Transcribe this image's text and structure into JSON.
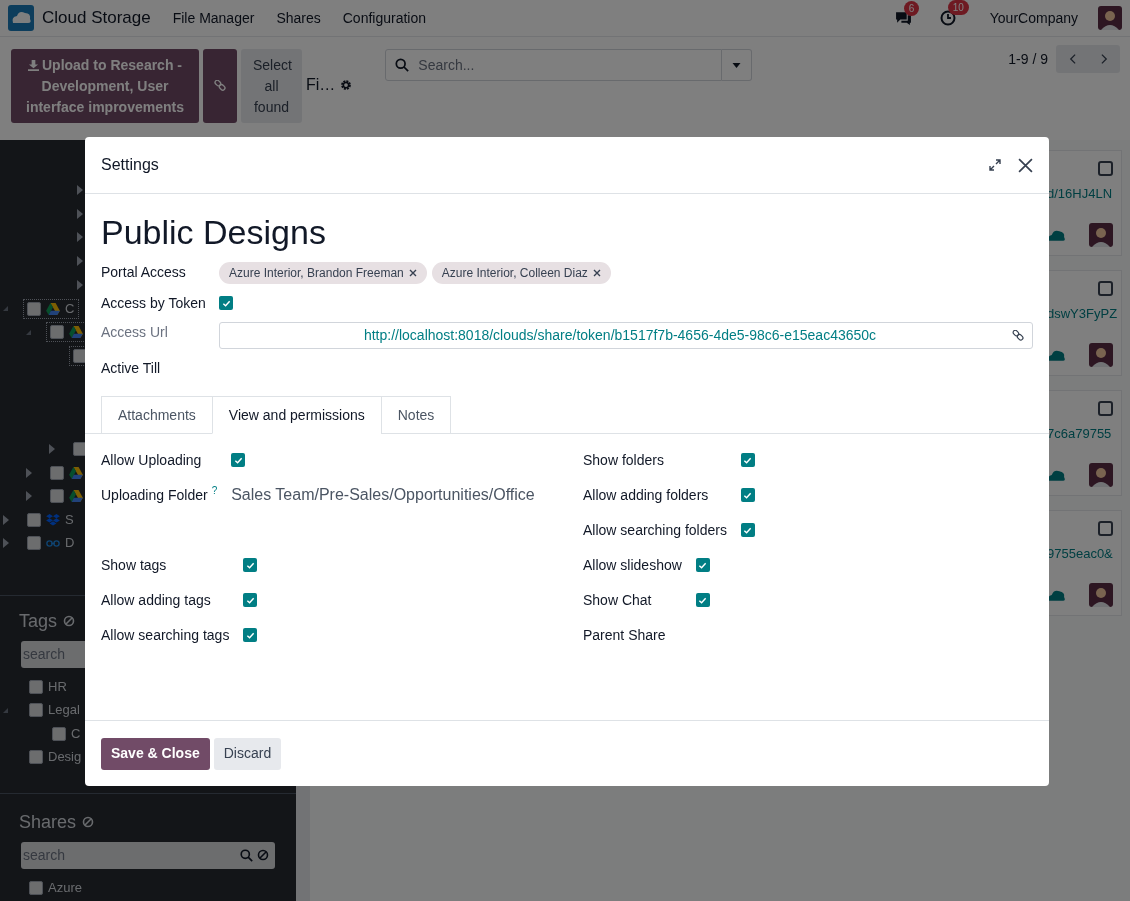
{
  "topbar": {
    "app_name": "Cloud Storage",
    "menu": [
      "File Manager",
      "Shares",
      "Configuration"
    ],
    "messages_count": "6",
    "activities_count": "10",
    "company": "YourCompany"
  },
  "control_panel": {
    "upload_button": "Upload to Research - Development, User interface improvements",
    "select_all_button": "Select all found",
    "filters_label": "Fi…",
    "search": {
      "placeholder": "Search..."
    },
    "pager": "1-9 / 9"
  },
  "sidebar": {
    "scrolled_rows": [
      {
        "expanded": false
      },
      {
        "expanded": false
      },
      {
        "expanded": false
      },
      {
        "expanded": false
      },
      {
        "expanded": false
      }
    ],
    "tree": [
      {
        "label": "C",
        "kind": "drive",
        "expanded": true,
        "checked": false,
        "focused": true,
        "children": [
          {
            "kind": "drive",
            "expanded": true,
            "checked": false,
            "focused": true,
            "children": [
              {
                "checked": false,
                "focused": true
              },
              {
                "expanded": false,
                "checked": false
              }
            ]
          },
          {
            "kind": "drive",
            "expanded": false,
            "checked": false
          },
          {
            "kind": "drive",
            "expanded": false,
            "checked": false
          }
        ]
      },
      {
        "label": "S",
        "kind": "dropbox",
        "expanded": false,
        "checked": false
      },
      {
        "label": "D",
        "kind": "cloud-link",
        "expanded": false,
        "checked": false
      }
    ],
    "tags": {
      "title": "Tags",
      "search_placeholder": "search",
      "items": [
        {
          "label": "HR",
          "checked": false
        },
        {
          "label": "Legal",
          "checked": false,
          "expanded": true,
          "children": [
            {
              "label": "C",
              "checked": false
            }
          ]
        },
        {
          "label": "Desig",
          "checked": false
        }
      ]
    },
    "shares": {
      "title": "Shares",
      "search_placeholder": "search",
      "items": [
        {
          "label": "Azure",
          "checked": false
        }
      ]
    }
  },
  "cards": [
    {
      "text": "d/16HJ4LN",
      "checked": false
    },
    {
      "text": "dswY3FyPZ",
      "checked": false
    },
    {
      "text": "7c6a79755",
      "checked": false
    },
    {
      "text": "9755eac0&",
      "checked": false
    }
  ],
  "dialog": {
    "title": "Settings",
    "record_name": "Public Designs",
    "fields": [
      {
        "kind": "tags",
        "label": "Portal Access",
        "tags": [
          "Azure Interior, Brandon Freeman",
          "Azure Interior, Colleen Diaz"
        ]
      },
      {
        "kind": "checkbox",
        "label": "Access by Token",
        "checked": true
      },
      {
        "kind": "url",
        "label": "Access Url",
        "value": "http://localhost:8018/clouds/share/token/b1517f7b-4656-4de5-98c6-e15eac43650c"
      },
      {
        "kind": "empty",
        "label": "Active Till"
      }
    ],
    "tabs": [
      {
        "label": "Attachments",
        "selected": false
      },
      {
        "label": "View and permissions",
        "selected": true
      },
      {
        "label": "Notes",
        "selected": false
      }
    ],
    "permission_groups": [
      {
        "fields": [
          {
            "kind": "checkbox",
            "label": "Allow Uploading",
            "checked": true
          },
          {
            "kind": "text",
            "label": "Uploading Folder",
            "help_mark": "?",
            "value": "Sales Team/Pre-Sales/Opportunities/Office"
          }
        ]
      },
      {
        "fields": [
          {
            "kind": "checkbox",
            "label": "Show folders",
            "checked": true
          },
          {
            "kind": "checkbox",
            "label": "Allow adding folders",
            "checked": true
          },
          {
            "kind": "checkbox",
            "label": "Allow searching folders",
            "checked": true
          }
        ]
      },
      {
        "fields": [
          {
            "kind": "checkbox",
            "label": "Show tags",
            "checked": true
          },
          {
            "kind": "checkbox",
            "label": "Allow adding tags",
            "checked": true
          },
          {
            "kind": "checkbox",
            "label": "Allow searching tags",
            "checked": true
          }
        ]
      },
      {
        "fields": [
          {
            "kind": "checkbox",
            "label": "Allow slideshow",
            "checked": true
          },
          {
            "kind": "checkbox",
            "label": "Show Chat",
            "checked": true
          },
          {
            "kind": "empty",
            "label": "Parent Share"
          }
        ]
      }
    ],
    "buttons": [
      {
        "kind": "primary",
        "label": "Save & Close"
      },
      {
        "kind": "secondary",
        "label": "Discard"
      }
    ]
  }
}
